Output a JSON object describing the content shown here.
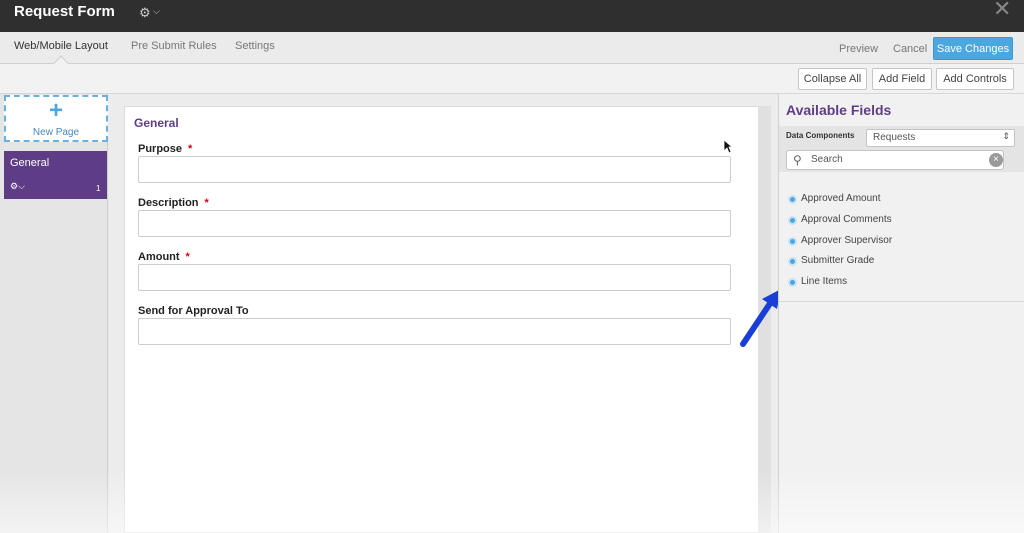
{
  "window": {
    "title": "Request Form"
  },
  "tabs": [
    {
      "label": "Web/Mobile Layout"
    },
    {
      "label": "Pre Submit Rules"
    },
    {
      "label": "Settings"
    }
  ],
  "header_actions": {
    "preview": "Preview",
    "cancel": "Cancel",
    "save": "Save Changes"
  },
  "toolbar": {
    "collapse_all": "Collapse All",
    "add_field": "Add Field",
    "add_controls": "Add Controls"
  },
  "pages_panel": {
    "new_page_label": "New Page",
    "pages": [
      {
        "name": "General",
        "count": "1"
      }
    ]
  },
  "form": {
    "section_title": "General",
    "required_marker": "*",
    "fields": [
      {
        "label": "Purpose",
        "value": ""
      },
      {
        "label": "Description",
        "value": ""
      },
      {
        "label": "Amount",
        "value": ""
      },
      {
        "label": "Send for Approval To",
        "value": ""
      }
    ]
  },
  "available_fields": {
    "title": "Available Fields",
    "data_components_label": "Data Components",
    "data_components_value": "Requests",
    "search_placeholder": "Search",
    "items": [
      {
        "label": "Approved Amount"
      },
      {
        "label": "Approval Comments"
      },
      {
        "label": "Approver Supervisor"
      },
      {
        "label": "Submitter Grade"
      },
      {
        "label": "Line Items"
      }
    ]
  },
  "colors": {
    "accent_purple": "#5f3d86",
    "accent_blue": "#4aa7df",
    "title_bar": "#2f2f2f",
    "required_red": "#d0021b"
  },
  "icons": {
    "title_gear": "gear-icon",
    "close": "close-icon",
    "new_page": "plus-icon",
    "search": "search-icon",
    "clear": "clear-icon"
  }
}
